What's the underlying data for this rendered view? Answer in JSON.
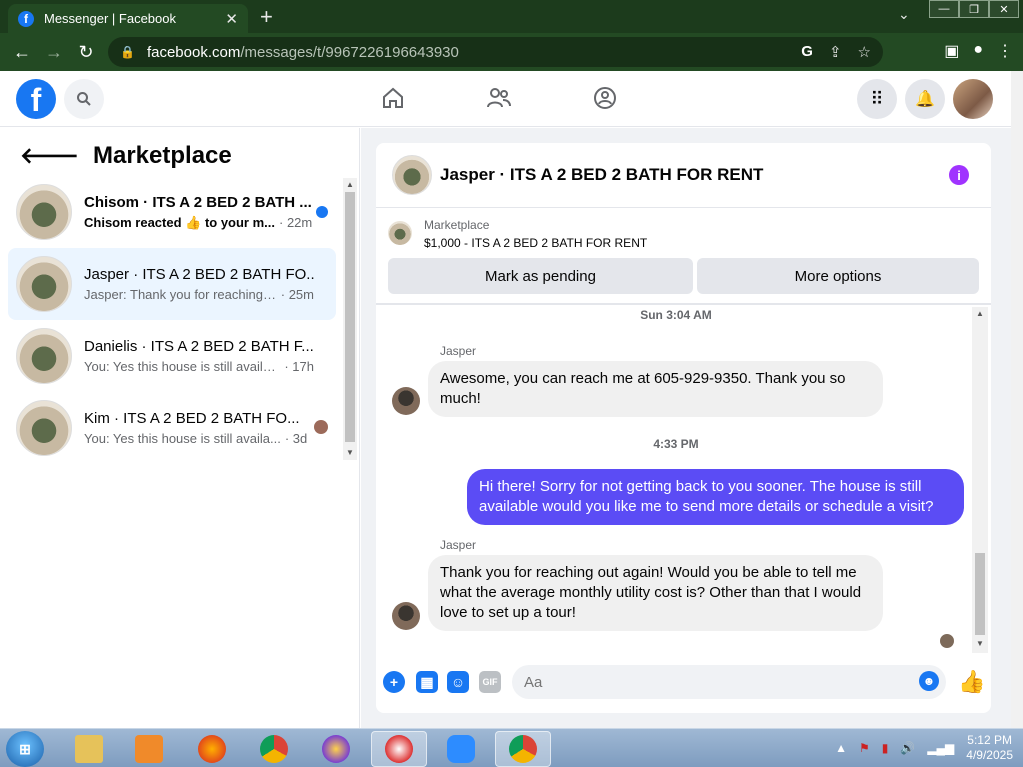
{
  "browser": {
    "tab_title": "Messenger | Facebook",
    "tab_close": "✕",
    "new_tab": "+",
    "url_domain": "facebook.com",
    "url_path": "/messages/t/9967226196643930"
  },
  "left": {
    "title": "Marketplace",
    "conversations": [
      {
        "name": "Chisom · ITS A 2 BED 2 BATH ...",
        "snippet": "Chisom reacted 👍 to your m...",
        "time": "· 22m"
      },
      {
        "name": "Jasper · ITS A 2 BED 2 BATH FO...",
        "snippet": "Jasper: Thank you for reaching o...",
        "time": "· 25m"
      },
      {
        "name": "Danielis · ITS A 2 BED 2 BATH F...",
        "snippet": "You: Yes this house is still availabl...",
        "time": "· 17h"
      },
      {
        "name": "Kim · ITS A 2 BED 2 BATH FO...",
        "snippet": "You: Yes this house is still availa...",
        "time": "· 3d"
      }
    ]
  },
  "chat": {
    "contact": "Jasper · ITS A 2 BED 2 BATH FOR RENT",
    "info_icon": "i",
    "listing_source": "Marketplace",
    "listing_price_title": "$1,000 - ITS A 2 BED 2 BATH FOR RENT",
    "btn_pending": "Mark as pending",
    "btn_more": "More options",
    "timestamp1": "Sun 3:04 AM",
    "sender1": "Jasper",
    "msg1": "Awesome, you can reach me at 605-929-9350. Thank you so much!",
    "timestamp2": "4:33 PM",
    "msg2": "Hi there! Sorry for not getting back to you sooner. The house is still available would you like me to send more details or schedule a visit?",
    "sender2": "Jasper",
    "msg3": "Thank you for reaching out again! Would you be able to tell me what the average monthly utility cost is? Other than that I would love to set up a tour!",
    "input_placeholder": "Aa",
    "gif_label": "GIF"
  },
  "taskbar": {
    "time": "5:12 PM",
    "date": "4/9/2025"
  },
  "colors": {
    "fb_blue": "#1877f2",
    "outgoing_bubble": "#5b4cf5",
    "active_conv": "#ebf5ff",
    "info_purple": "#a033ff"
  }
}
